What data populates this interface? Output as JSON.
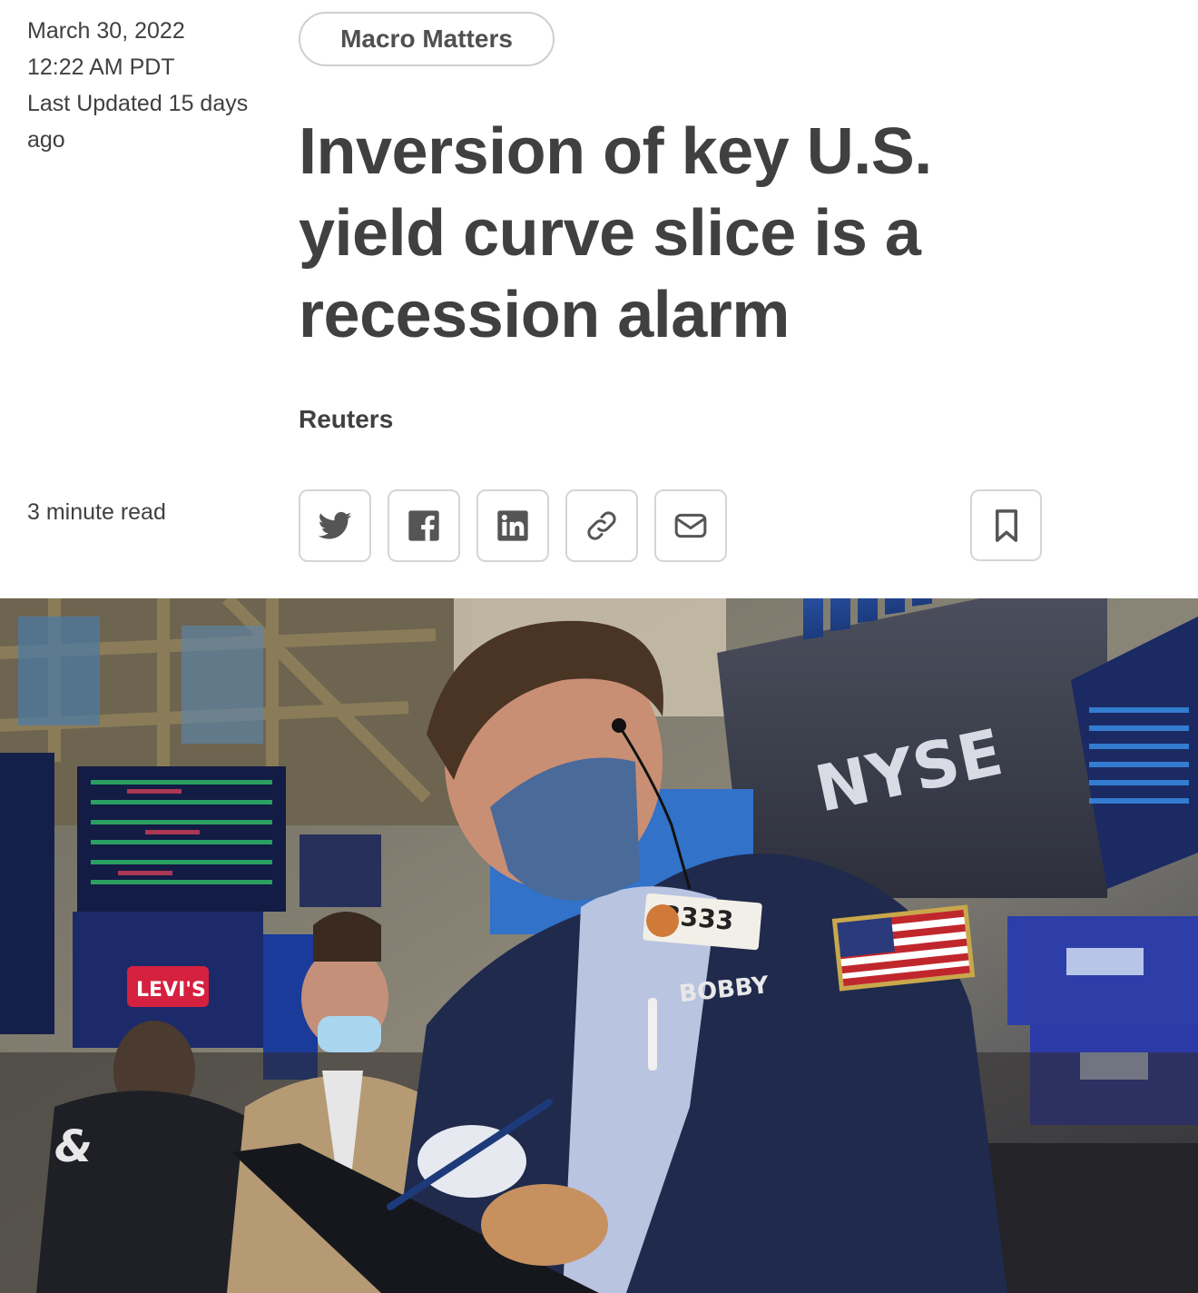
{
  "meta": {
    "date": "March 30, 2022",
    "time": "12:22 AM PDT",
    "last_updated": "Last Updated 15 days ago",
    "read_time": "3 minute read"
  },
  "article": {
    "tag": "Macro Matters",
    "headline": "Inversion of key U.S. yield curve slice is a recession alarm",
    "byline": "Reuters"
  },
  "share": {
    "icons": [
      "twitter-icon",
      "facebook-icon",
      "linkedin-icon",
      "link-icon",
      "email-icon"
    ],
    "bookmark_icon": "bookmark-icon"
  },
  "hero": {
    "sign_text": "NYSE",
    "badge_number": "3333",
    "name_tag": "BOBBY",
    "brand_screen": "LEVI'S",
    "colors": {
      "screen_blue": "#2f5fd0",
      "jacket_navy": "#1f2a4d",
      "mask_blue": "#4a6a9a"
    }
  }
}
